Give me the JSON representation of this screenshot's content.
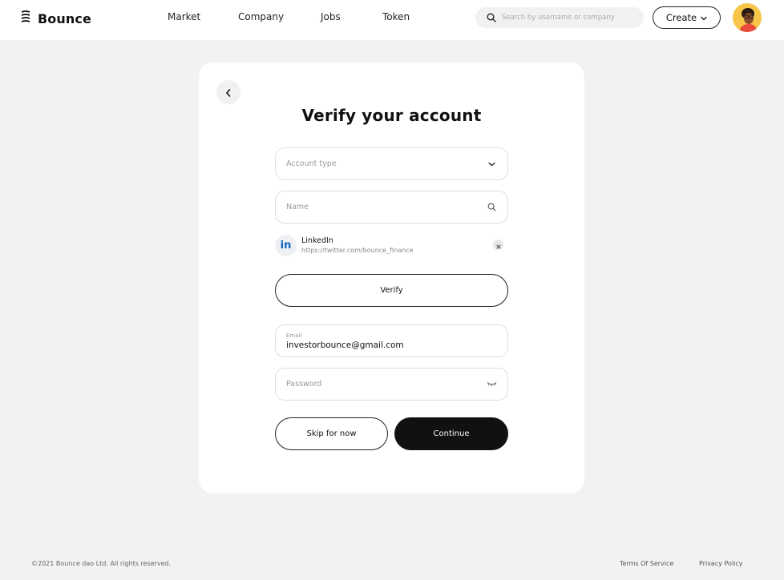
{
  "header": {
    "logo_text": "Bounce",
    "nav": [
      "Market",
      "Company",
      "Jobs",
      "Token"
    ],
    "search_placeholder": "Search by username or company",
    "create_label": "Create"
  },
  "card": {
    "title": "Verify your account",
    "account_type_placeholder": "Account type",
    "name_placeholder": "Name",
    "linked_account": {
      "name": "LinkedIn",
      "url": "https://twitter.com/bounce_finance",
      "badge": "in"
    },
    "verify_label": "Verify",
    "email_label": "Email",
    "email_value": "investorbounce@gmail.com",
    "password_placeholder": "Password",
    "skip_label": "Skip for now",
    "continue_label": "Continue"
  },
  "footer": {
    "copyright": "©2021 Bounce dao Ltd. All rights reserved.",
    "terms": "Terms Of Service",
    "privacy": "Privacy Policy"
  },
  "colors": {
    "page_bg": "#f2f2f2",
    "primary_dark": "#111111",
    "linkedin_blue": "#0a66c2",
    "avatar_bg": "#f7c548"
  }
}
